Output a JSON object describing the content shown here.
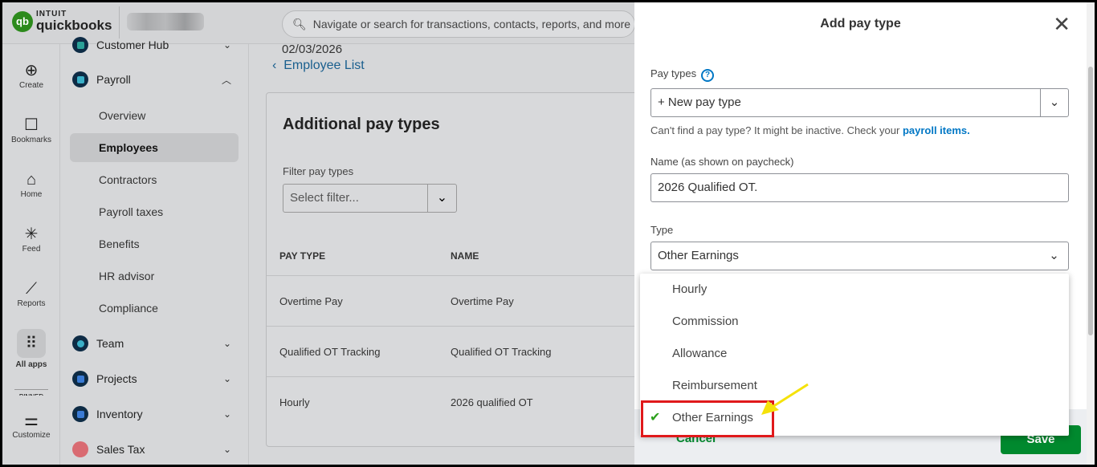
{
  "brand": {
    "top": "INTUIT",
    "name": "quickbooks",
    "mark": "qb"
  },
  "search": {
    "placeholder": "Navigate or search for transactions, contacts, reports, and more"
  },
  "rail": [
    {
      "label": "Create",
      "icon": "⊕"
    },
    {
      "label": "Bookmarks",
      "icon": "🔖"
    },
    {
      "label": "Home",
      "icon": "⌂"
    },
    {
      "label": "Feed",
      "icon": "✳"
    },
    {
      "label": "Reports",
      "icon": "📈"
    },
    {
      "label": "All apps",
      "icon": "⠿"
    },
    {
      "label": "PINNED",
      "icon": ""
    },
    {
      "label": "Customize",
      "icon": "⚌"
    }
  ],
  "nav": {
    "customer_hub": "Customer Hub",
    "payroll": "Payroll",
    "payroll_sub": [
      "Overview",
      "Employees",
      "Contractors",
      "Payroll taxes",
      "Benefits",
      "HR advisor",
      "Compliance"
    ],
    "team": "Team",
    "projects": "Projects",
    "inventory": "Inventory",
    "sales_tax": "Sales Tax"
  },
  "main": {
    "date": "02/03/2026",
    "back": "Employee List",
    "title": "Additional pay types",
    "filter_label": "Filter pay types",
    "filter_placeholder": "Select filter...",
    "columns": [
      "PAY TYPE",
      "NAME"
    ],
    "rows": [
      [
        "Overtime Pay",
        "Overtime Pay"
      ],
      [
        "Qualified OT Tracking",
        "Qualified OT Tracking"
      ],
      [
        "Hourly",
        "2026 qualified OT"
      ]
    ]
  },
  "drawer": {
    "title": "Add pay type",
    "pay_types_label": "Pay types",
    "pay_types_value": "+ New pay type",
    "hint": "Can't find a pay type? It might be inactive. Check your",
    "hint_link": "payroll items.",
    "name_label": "Name (as shown on paycheck)",
    "name_value": "2026 Qualified OT.",
    "type_label": "Type",
    "type_value": "Other Earnings",
    "options": [
      "Hourly",
      "Commission",
      "Allowance",
      "Reimbursement",
      "Other Earnings"
    ],
    "selected": "Other Earnings",
    "cancel": "Cancel",
    "save": "Save"
  }
}
